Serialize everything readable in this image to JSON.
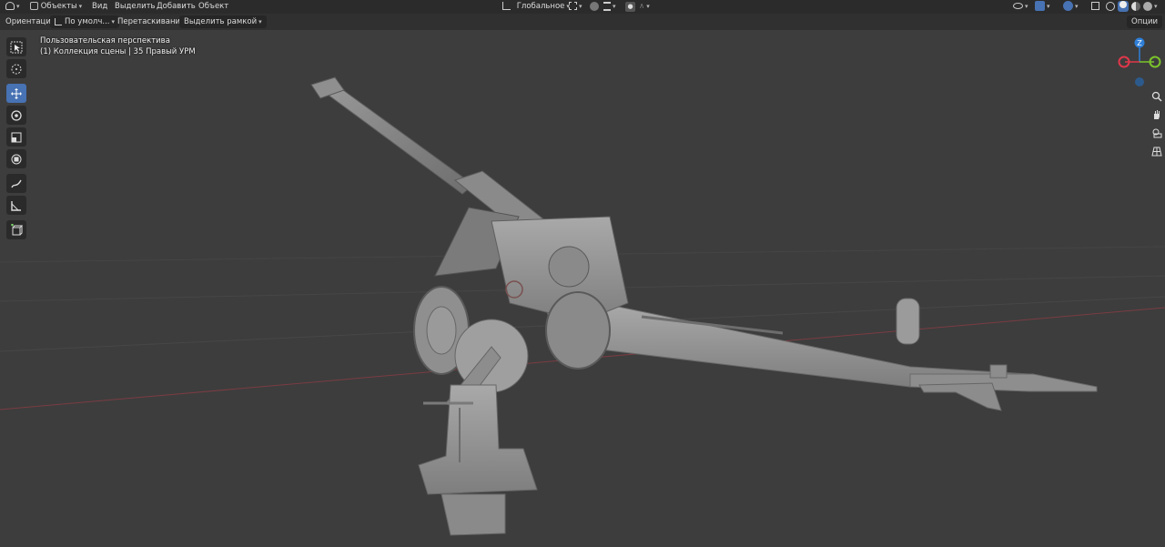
{
  "header": {
    "mode_label": "Объекты",
    "menu": [
      "Вид",
      "Выделить",
      "Добавить",
      "Объект"
    ],
    "transform_orientation": "Глобальное"
  },
  "toolbar_settings": {
    "orientation_label": "Ориентация:",
    "orientation_value": "По умолч...",
    "drag_label": "Перетаскивание:",
    "drag_value": "Выделить рамкой",
    "options_label": "Опции"
  },
  "viewport": {
    "perspective_text": "Пользовательская перспектива",
    "collection_text": "(1) Коллекция сцены | 35 Правый УРМ"
  },
  "tools": [
    {
      "name": "select-box-tool",
      "icon": "cursor-box-icon",
      "active": false
    },
    {
      "name": "cursor-tool",
      "icon": "crosshair-icon",
      "active": false
    },
    {
      "name": "move-tool",
      "icon": "move-arrows-icon",
      "active": true
    },
    {
      "name": "rotate-tool",
      "icon": "rotate-icon",
      "active": false
    },
    {
      "name": "scale-tool",
      "icon": "scale-icon",
      "active": false
    },
    {
      "name": "transform-tool",
      "icon": "transform-icon",
      "active": false
    },
    {
      "name": "annotate-tool",
      "icon": "pencil-icon",
      "active": false
    },
    {
      "name": "measure-tool",
      "icon": "ruler-icon",
      "active": false
    },
    {
      "name": "add-cube-tool",
      "icon": "cube-add-icon",
      "active": false
    }
  ],
  "gizmo": {
    "z_label": "Z",
    "x_color": "#e0374a",
    "y_color": "#7bc42b",
    "z_color": "#2e7fd8"
  },
  "right_tools": [
    "zoom-icon",
    "hand-icon",
    "camera-icon",
    "grid-icon"
  ],
  "colors": {
    "accent": "#4772b3",
    "viewport_bg": "#3d3d3d",
    "header_bg": "#2b2b2b"
  }
}
